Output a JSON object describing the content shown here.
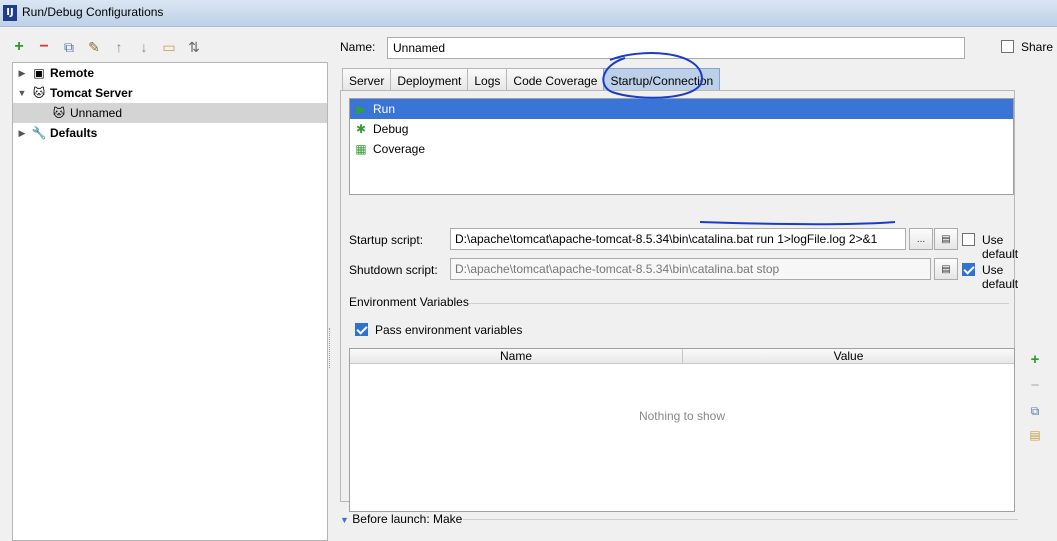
{
  "window": {
    "title": "Run/Debug Configurations",
    "app_icon_glyph": "IJ"
  },
  "toolbar": {
    "buttons": [
      {
        "icon": "plus-icon",
        "glyph": "+",
        "color": "#2a9a2a"
      },
      {
        "icon": "minus-icon",
        "glyph": "−",
        "color": "#d03c2c"
      },
      {
        "icon": "copy-icon",
        "glyph": "⧉",
        "color": "#5577aa"
      },
      {
        "icon": "wrench-icon",
        "glyph": "✎",
        "color": "#8a6a30"
      },
      {
        "icon": "arrow-up-icon",
        "glyph": "↑",
        "color": "#888888"
      },
      {
        "icon": "arrow-down-icon",
        "glyph": "↓",
        "color": "#888888"
      },
      {
        "icon": "folder-icon",
        "glyph": "▭",
        "color": "#c8a040"
      },
      {
        "icon": "sort-icon",
        "glyph": "⇅",
        "color": "#666666"
      }
    ]
  },
  "tree": {
    "items": [
      {
        "label": "Remote",
        "arrow": "▶",
        "icon": "remote-icon",
        "glyph": "▣",
        "bold": true
      },
      {
        "label": "Tomcat Server",
        "arrow": "▼",
        "icon": "tomcat-icon",
        "glyph": "🐱",
        "bold": true
      },
      {
        "label": "Unnamed",
        "arrow": "",
        "icon": "tomcat-config-icon",
        "glyph": "🐱",
        "bold": false
      },
      {
        "label": "Defaults",
        "arrow": "▶",
        "icon": "wrench-icon",
        "glyph": "🔧",
        "bold": true
      }
    ]
  },
  "name_field": {
    "label": "Name:",
    "value": "Unnamed"
  },
  "share": {
    "label": "Share",
    "checked": false
  },
  "tabs": [
    {
      "label": "Server",
      "active": false
    },
    {
      "label": "Deployment",
      "active": false
    },
    {
      "label": "Logs",
      "active": false
    },
    {
      "label": "Code Coverage",
      "active": false
    },
    {
      "label": "Startup/Connection",
      "active": true
    }
  ],
  "modes": [
    {
      "label": "Run",
      "icon": "run-icon",
      "selected": true
    },
    {
      "label": "Debug",
      "icon": "debug-icon",
      "selected": false
    },
    {
      "label": "Coverage",
      "icon": "coverage-icon",
      "selected": false
    }
  ],
  "startup": {
    "label": "Startup script:",
    "value": "D:\\apache\\tomcat\\apache-tomcat-8.5.34\\bin\\catalina.bat run 1>logFile.log 2>&1",
    "browse_label": "...",
    "use_default_label": "Use default",
    "use_default_checked": false
  },
  "shutdown": {
    "label": "Shutdown script:",
    "value": "D:\\apache\\tomcat\\apache-tomcat-8.5.34\\bin\\catalina.bat stop",
    "use_default_label": "Use default",
    "use_default_checked": true
  },
  "env": {
    "section_title": "Environment Variables",
    "pass_label": "Pass environment variables",
    "pass_checked": true,
    "columns": [
      "Name",
      "Value"
    ],
    "empty_text": "Nothing to show"
  },
  "before_launch": {
    "label": "Before launch: Make"
  },
  "colors": {
    "selection_blue": "#3875d7",
    "annotation_blue": "#1b3cc9",
    "active_tab": "#bdd0ea"
  }
}
